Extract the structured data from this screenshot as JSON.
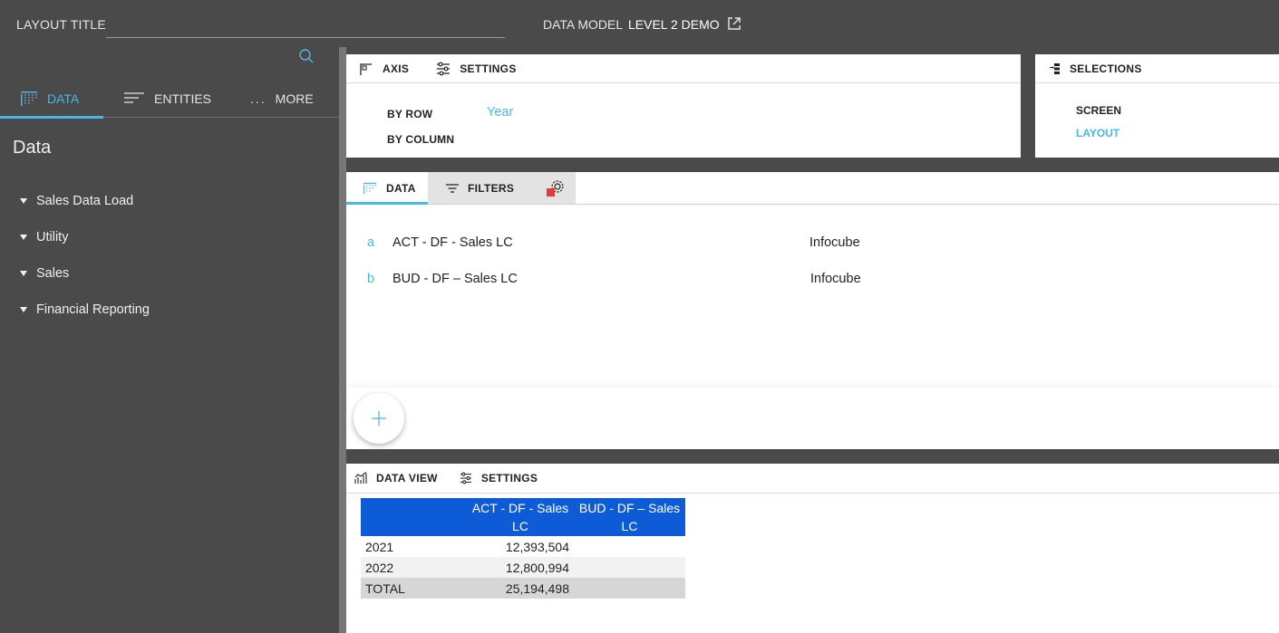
{
  "topbar": {
    "layout_title_label": "LAYOUT TITLE",
    "layout_title_value": "",
    "data_model_label": "DATA MODEL",
    "data_model_value": "LEVEL 2 DEMO",
    "open_icon": "external-link-icon"
  },
  "left_panel": {
    "search_icon": "search-icon",
    "tabs": [
      {
        "label": "DATA",
        "icon": "grid-dots-icon",
        "active": true
      },
      {
        "label": "ENTITIES",
        "icon": "list-lines-icon",
        "active": false
      },
      {
        "label": "MORE",
        "icon": "ellipsis-icon",
        "prefix": "...",
        "active": false
      }
    ],
    "heading": "Data",
    "tree": [
      {
        "label": "Sales Data Load"
      },
      {
        "label": "Utility"
      },
      {
        "label": "Sales"
      },
      {
        "label": "Financial Reporting"
      }
    ]
  },
  "axis_card": {
    "tabs": [
      {
        "label": "AXIS",
        "icon": "axis-icon"
      },
      {
        "label": "SETTINGS",
        "icon": "sliders-icon"
      }
    ],
    "by_row_label": "BY ROW",
    "by_row_value": "Year",
    "by_column_label": "BY COLUMN"
  },
  "selections_card": {
    "title": "SELECTIONS",
    "icon": "selection-tree-icon",
    "items": [
      {
        "label": "SCREEN",
        "active": false
      },
      {
        "label": "LAYOUT",
        "active": true
      }
    ]
  },
  "data_card": {
    "tabs": [
      {
        "label": "DATA",
        "icon": "grid-dots-icon",
        "active": true
      },
      {
        "label": "FILTERS",
        "icon": "filter-icon",
        "active": false
      },
      {
        "label": "",
        "icon": "gear-icon",
        "active": false
      }
    ],
    "measures": [
      {
        "letter": "a",
        "name": "ACT - DF - Sales LC",
        "type": "Infocube"
      },
      {
        "letter": "b",
        "name": "BUD - DF – Sales LC",
        "type": "Infocube"
      }
    ],
    "add_icon": "plus-icon"
  },
  "dataview_card": {
    "tabs": [
      {
        "label": "DATA VIEW",
        "icon": "bar-chart-icon"
      },
      {
        "label": "SETTINGS",
        "icon": "sliders-icon"
      }
    ],
    "table": {
      "columns": [
        "",
        "ACT - DF - Sales LC",
        "BUD - DF – Sales LC"
      ],
      "rows": [
        {
          "label": "2021",
          "act": "12,393,504",
          "bud": ""
        },
        {
          "label": "2022",
          "act": "12,800,994",
          "bud": ""
        },
        {
          "label": "TOTAL",
          "act": "25,194,498",
          "bud": ""
        }
      ]
    }
  },
  "colors": {
    "accent": "#49b8e6",
    "table_header": "#0d5bd7",
    "background": "#4a4a4a",
    "alert": "#e53935"
  }
}
